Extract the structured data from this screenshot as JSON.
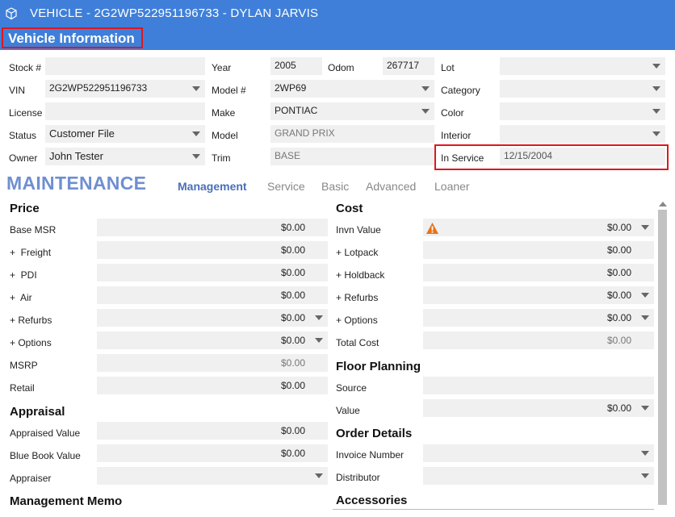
{
  "window": {
    "title": "VEHICLE - 2G2WP522951196733 - DYLAN JARVIS",
    "icon": "cube-icon"
  },
  "header": {
    "title": "Vehicle Information"
  },
  "vehicle": {
    "stock_label": "Stock #",
    "stock_value": "",
    "vin_label": "VIN",
    "vin_value": "2G2WP522951196733",
    "license_label": "License",
    "license_value": "",
    "status_label": "Status",
    "status_value": "Customer File",
    "owner_label": "Owner",
    "owner_value": "John Tester",
    "year_label": "Year",
    "year_value": "2005",
    "odom_label": "Odom",
    "odom_value": "267717",
    "model_num_label": "Model #",
    "model_num_value": "2WP69",
    "make_label": "Make",
    "make_value": "PONTIAC",
    "model_label": "Model",
    "model_value": "GRAND PRIX",
    "trim_label": "Trim",
    "trim_value": "BASE",
    "lot_label": "Lot",
    "lot_value": "",
    "category_label": "Category",
    "category_value": "",
    "color_label": "Color",
    "color_value": "",
    "interior_label": "Interior",
    "interior_value": "",
    "in_service_label": "In Service",
    "in_service_value": "12/15/2004"
  },
  "maintenance": {
    "title": "MAINTENANCE",
    "tabs": [
      "Management",
      "Service",
      "Basic",
      "Advanced",
      "Loaner"
    ],
    "active_tab": "Management"
  },
  "price": {
    "title": "Price",
    "rows": [
      {
        "label": "Base MSR",
        "value": "$0.00"
      },
      {
        "label": "+  Freight",
        "value": "$0.00"
      },
      {
        "label": "+  PDI",
        "value": "$0.00"
      },
      {
        "label": "+  Air",
        "value": "$0.00"
      },
      {
        "label": "+ Refurbs",
        "value": "$0.00"
      },
      {
        "label": "+ Options",
        "value": "$0.00"
      },
      {
        "label": "MSRP",
        "value": "$0.00"
      },
      {
        "label": "Retail",
        "value": "$0.00"
      }
    ]
  },
  "appraisal": {
    "title": "Appraisal",
    "rows": [
      {
        "label": "Appraised Value",
        "value": "$0.00"
      },
      {
        "label": "Blue Book Value",
        "value": "$0.00"
      },
      {
        "label": "Appraiser",
        "value": ""
      }
    ]
  },
  "memo": {
    "title": "Management Memo"
  },
  "cost": {
    "title": "Cost",
    "rows": [
      {
        "label": "Invn Value",
        "value": "$0.00"
      },
      {
        "label": "+ Lotpack",
        "value": "$0.00"
      },
      {
        "label": "+ Holdback",
        "value": "$0.00"
      },
      {
        "label": "+ Refurbs",
        "value": "$0.00"
      },
      {
        "label": "+ Options",
        "value": "$0.00"
      },
      {
        "label": "Total Cost",
        "value": "$0.00"
      }
    ]
  },
  "floor_planning": {
    "title": "Floor Planning",
    "source_label": "Source",
    "source_value": "",
    "value_label": "Value",
    "value_value": "$0.00"
  },
  "order_details": {
    "title": "Order Details",
    "invoice_label": "Invoice Number",
    "invoice_value": "",
    "distributor_label": "Distributor",
    "distributor_value": ""
  },
  "accessories": {
    "title": "Accessories"
  },
  "colors": {
    "titlebar": "#3f7fd9",
    "highlight": "#e0161f",
    "maintenance": "#6f8fd1",
    "warning": "#e8731a"
  }
}
